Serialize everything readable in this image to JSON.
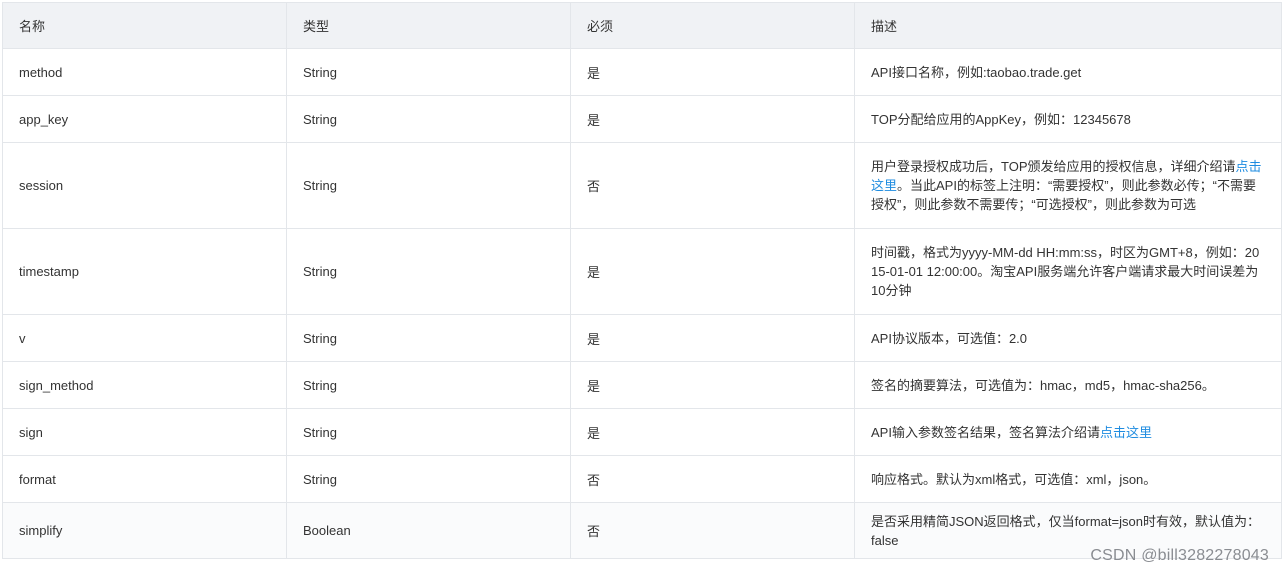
{
  "headers": [
    "名称",
    "类型",
    "必须",
    "描述"
  ],
  "rows": [
    {
      "name": "method",
      "type": "String",
      "required": "是",
      "desc": "API接口名称，例如:taobao.trade.get"
    },
    {
      "name": "app_key",
      "type": "String",
      "required": "是",
      "desc": "TOP分配给应用的AppKey，例如：12345678"
    },
    {
      "name": "session",
      "type": "String",
      "required": "否",
      "desc_pre": "用户登录授权成功后，TOP颁发给应用的授权信息，详细介绍请",
      "desc_link": "点击这里",
      "desc_post": "。当此API的标签上注明：“需要授权”，则此参数必传；“不需要授权”，则此参数不需要传；“可选授权”，则此参数为可选"
    },
    {
      "name": "timestamp",
      "type": "String",
      "required": "是",
      "desc": "时间戳，格式为yyyy-MM-dd HH:mm:ss，时区为GMT+8，例如：2015-01-01 12:00:00。淘宝API服务端允许客户端请求最大时间误差为10分钟"
    },
    {
      "name": "v",
      "type": "String",
      "required": "是",
      "desc": "API协议版本，可选值：2.0"
    },
    {
      "name": "sign_method",
      "type": "String",
      "required": "是",
      "desc": "签名的摘要算法，可选值为：hmac，md5，hmac-sha256。"
    },
    {
      "name": "sign",
      "type": "String",
      "required": "是",
      "desc_pre": "API输入参数签名结果，签名算法介绍请",
      "desc_link": "点击这里",
      "desc_post": ""
    },
    {
      "name": "format",
      "type": "String",
      "required": "否",
      "desc": "响应格式。默认为xml格式，可选值：xml，json。"
    },
    {
      "name": "simplify",
      "type": "Boolean",
      "required": "否",
      "desc": "是否采用精简JSON返回格式，仅当format=json时有效，默认值为：false"
    }
  ],
  "watermark": "CSDN @bill3282278043",
  "colors": {
    "link": "#1f8ce0",
    "header_bg": "#f0f2f5",
    "border": "#e3e6ea"
  }
}
